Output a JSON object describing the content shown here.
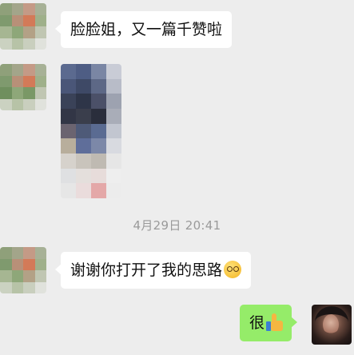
{
  "messages": {
    "m1": {
      "text": "脸脸姐，又一篇千赞啦"
    },
    "m2": {
      "text": "谢谢你打开了我的思路",
      "emoji": "hugging-face-emoji"
    },
    "m3": {
      "text": "很",
      "emoji": "thumbs-up-emoji"
    }
  },
  "timestamp": "4月29日 20:41",
  "colors": {
    "background": "#ededed",
    "incoming_bubble": "#ffffff",
    "outgoing_bubble": "#95ec69",
    "timestamp_text": "#9a9a9a"
  },
  "image_message": {
    "state": "blurred"
  },
  "avatars": {
    "contact": "pixelated",
    "self": "photo"
  }
}
